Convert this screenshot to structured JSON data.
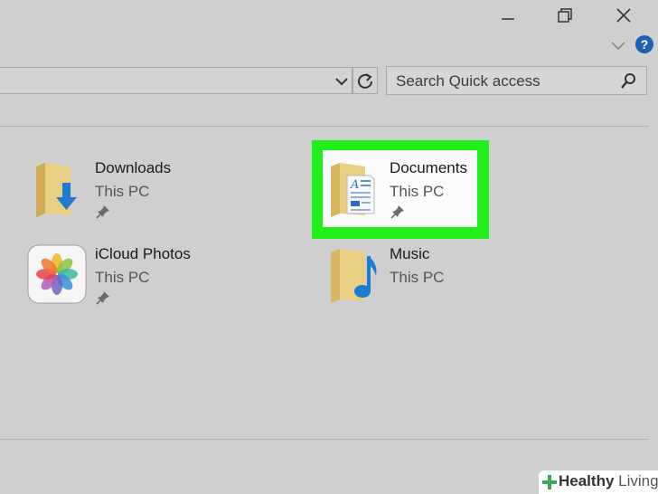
{
  "window": {
    "minimize_label": "—",
    "accent": "#22ee1b"
  },
  "toolbar": {
    "search_placeholder": "Search Quick access"
  },
  "items": [
    {
      "name": "Downloads",
      "location": "This PC",
      "icon": "downloads-folder-icon",
      "pinned": true
    },
    {
      "name": "Documents",
      "location": "This PC",
      "icon": "documents-folder-icon",
      "pinned": true,
      "highlighted": true
    },
    {
      "name": "iCloud Photos",
      "location": "This PC",
      "icon": "icloud-photos-icon",
      "pinned": true
    },
    {
      "name": "Music",
      "location": "This PC",
      "icon": "music-folder-icon",
      "pinned": false
    }
  ],
  "watermark": {
    "brand_bold": "Healthy",
    "brand_light": " Living"
  }
}
